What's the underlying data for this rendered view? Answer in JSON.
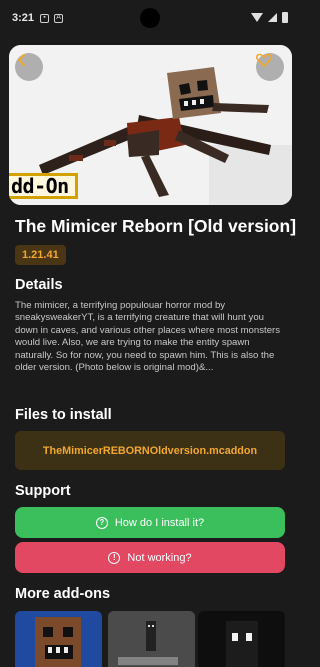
{
  "status_bar": {
    "time": "3:21"
  },
  "addon": {
    "title": "The Mimicer Reborn [Old version]",
    "version": "1.21.41",
    "banner_text": "dd-On",
    "description": "The mimicer, a terrifying populouar horror mod by sneakysweakerYT, is a terrifying creature that will hunt you down in caves, and various other places where most monsters would live. Also, we are trying to make the entity spawn naturally. So for now, you need to spawn him. This is also the older version. (Photo below is original mod)&..."
  },
  "sections": {
    "details": "Details",
    "files": "Files to install",
    "support": "Support",
    "more": "More add-ons"
  },
  "files": [
    {
      "name": "TheMimicerREBORNOldversion.mcaddon"
    }
  ],
  "support": {
    "install_label": "How do I install it?",
    "notworking_label": "Not working?"
  },
  "colors": {
    "background": "#1b1b1c",
    "accent_gold": "#f0a830",
    "green": "#3bbf5c",
    "red": "#e34862"
  },
  "icons": {
    "back": "chevron-left-icon",
    "favorite": "heart-icon",
    "help": "question-circle-icon",
    "alert": "exclamation-circle-icon"
  }
}
